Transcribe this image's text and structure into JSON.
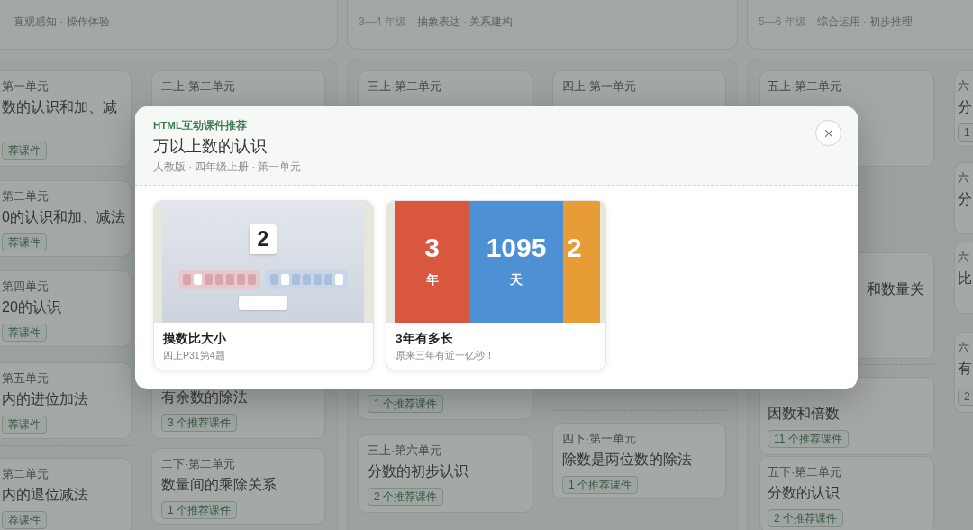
{
  "stages": [
    {
      "focus": "直观感知 · 操作体验",
      "columns": [
        [
          {
            "label": "第一单元",
            "title": "数的认识和加、减",
            "badge": "荐课件"
          },
          {
            "label": "第二单元",
            "title": "0的认识和加、减法",
            "badge": "荐课件"
          },
          {
            "label": "第四单元",
            "title": "20的认识",
            "badge": "荐课件"
          },
          {
            "label": "第五单元",
            "title": "内的进位加法",
            "badge": "荐课件"
          },
          {
            "label": "第二单元",
            "title": "内的退位减法",
            "badge": "荐课件"
          }
        ],
        [
          {
            "label": "二上·第二单元"
          },
          {
            "title": "有余数的除法",
            "badge": "3 个推荐课件"
          },
          {
            "label": "二下·第二单元",
            "title": "数量间的乘除关系",
            "badge": "1 个推荐课件"
          }
        ]
      ]
    },
    {
      "grade": "3—4 年级",
      "focus": "抽象表达 · 关系建构",
      "columns": [
        [
          {
            "label": "三上·第二单元"
          },
          {
            "badge": "1 个推荐课件"
          },
          {
            "label": "三上·第六单元",
            "title": "分数的初步认识",
            "badge": "2 个推荐课件"
          }
        ],
        [
          {
            "label": "四上·第一单元"
          },
          {
            "label": "四下·第一单元",
            "title": "除数是两位数的除法",
            "badge": "1 个推荐课件"
          }
        ]
      ]
    },
    {
      "grade": "5—6 年级",
      "focus": "综合运用 · 初步推理",
      "columns": [
        [
          {
            "label": "五上·第二单元"
          },
          {
            "title": "和数量关"
          },
          {
            "title": "因数和倍数",
            "badge": "11 个推荐课件"
          },
          {
            "label": "五下·第二单元",
            "title": "分数的认识",
            "badge": "2 个推荐课件"
          }
        ],
        [
          {
            "label": "六",
            "title": "分",
            "badge": "1"
          },
          {
            "label": "六",
            "title": "分"
          },
          {
            "label": "六",
            "title": "比"
          },
          {
            "label": "六",
            "title": "有",
            "badge": "2"
          }
        ]
      ]
    }
  ],
  "modal": {
    "tag": "HTML互动课件推荐",
    "title": "万以上数的认识",
    "meta": "人教版 · 四年级上册 · 第一单元",
    "courses": [
      {
        "title": "摸数比大小",
        "subtitle": "四上P31第4题",
        "thumbnail": {
          "kind": "number-card",
          "number": "2"
        }
      },
      {
        "title": "3年有多长",
        "subtitle": "原来三年有近一亿秒！",
        "thumbnail": {
          "kind": "stats",
          "panels": [
            {
              "value": "3",
              "unit": "年",
              "color": "#d9573f"
            },
            {
              "value": "1095",
              "unit": "天",
              "color": "#4d90d3"
            },
            {
              "value": "2",
              "color": "#e89c36"
            }
          ]
        }
      }
    ]
  }
}
